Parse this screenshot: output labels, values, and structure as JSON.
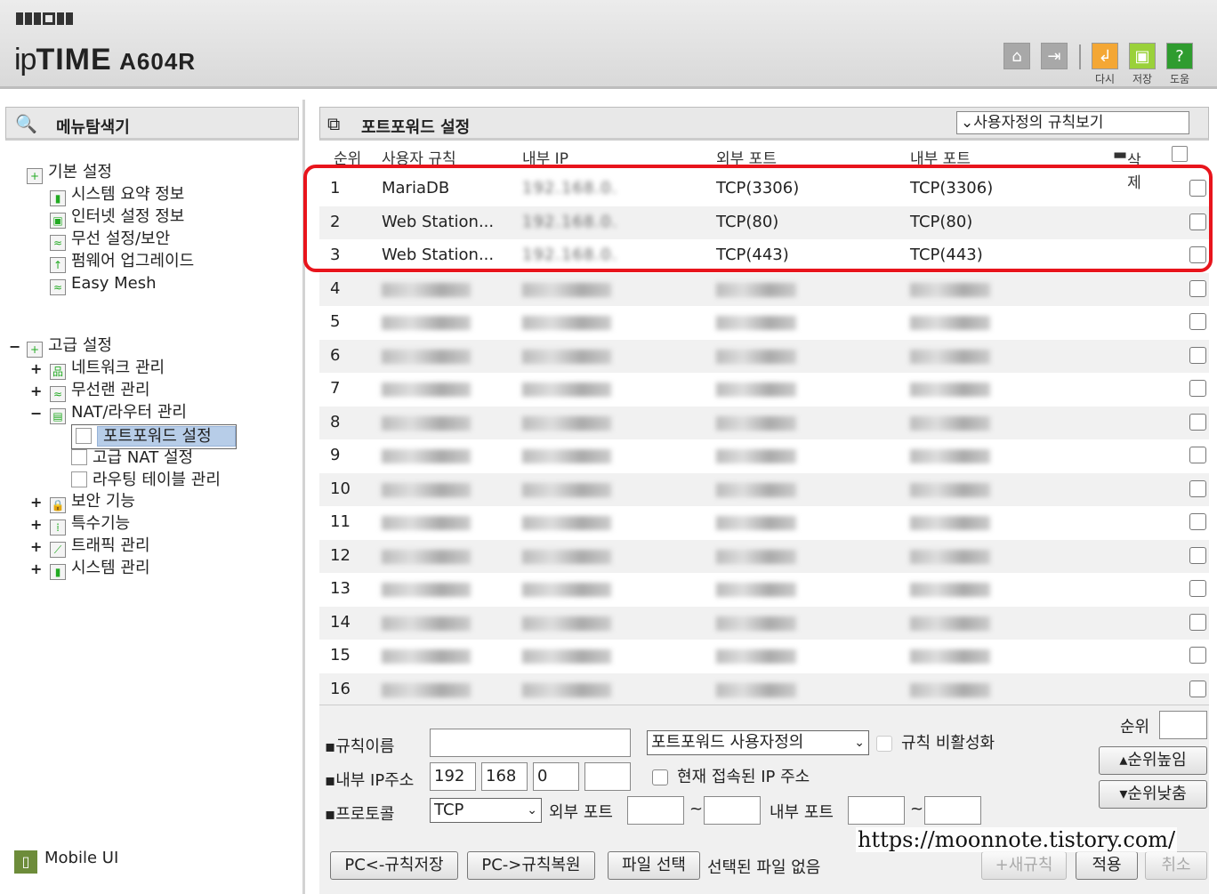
{
  "header": {
    "product": "A604R",
    "brand_prefix": "ip",
    "brand_main": "TIME",
    "toolbar": [
      {
        "icon": "home-icon",
        "label": ""
      },
      {
        "icon": "logout-icon",
        "label": ""
      },
      {
        "icon": "restart-icon",
        "label": "다시"
      },
      {
        "icon": "save-icon",
        "label": "저장"
      },
      {
        "icon": "help-icon",
        "label": "도움"
      }
    ]
  },
  "sidebar": {
    "title": "메뉴탐색기",
    "basic": {
      "label": "기본 설정",
      "items": [
        "시스템 요약 정보",
        "인터넷 설정 정보",
        "무선 설정/보안",
        "펌웨어 업그레이드",
        "Easy Mesh"
      ]
    },
    "advanced": {
      "label": "고급 설정",
      "items": [
        "네트워크 관리",
        "무선랜 관리",
        "NAT/라우터 관리",
        "보안 기능",
        "특수기능",
        "트래픽 관리",
        "시스템 관리"
      ],
      "nat_children": [
        "포트포워드 설정",
        "고급 NAT 설정",
        "라우팅 테이블 관리"
      ]
    },
    "mobile": "Mobile UI"
  },
  "main": {
    "title": "포트포워드 설정",
    "view_select": "사용자정의 규칙보기",
    "columns": {
      "rank": "순위",
      "rule": "사용자 규칙",
      "internal_ip": "내부 IP",
      "external_port": "외부 포트",
      "internal_port": "내부 포트",
      "delete": "삭제"
    },
    "rows": [
      {
        "n": "1",
        "rule": "MariaDB",
        "ip": "192.168.0.",
        "ext": "TCP(3306)",
        "int": "TCP(3306)"
      },
      {
        "n": "2",
        "rule": "Web Station...",
        "ip": "192.168.0.",
        "ext": "TCP(80)",
        "int": "TCP(80)"
      },
      {
        "n": "3",
        "rule": "Web Station...",
        "ip": "192.168.0.",
        "ext": "TCP(443)",
        "int": "TCP(443)"
      },
      {
        "n": "4",
        "rule": "",
        "ip": "",
        "ext": "",
        "int": ""
      },
      {
        "n": "5",
        "rule": "",
        "ip": "",
        "ext": "",
        "int": ""
      },
      {
        "n": "6",
        "rule": "",
        "ip": "",
        "ext": "",
        "int": ""
      },
      {
        "n": "7",
        "rule": "",
        "ip": "",
        "ext": "",
        "int": ""
      },
      {
        "n": "8",
        "rule": "",
        "ip": "",
        "ext": "",
        "int": ""
      },
      {
        "n": "9",
        "rule": "",
        "ip": "",
        "ext": "",
        "int": ""
      },
      {
        "n": "10",
        "rule": "",
        "ip": "",
        "ext": "",
        "int": ""
      },
      {
        "n": "11",
        "rule": "",
        "ip": "",
        "ext": "",
        "int": ""
      },
      {
        "n": "12",
        "rule": "",
        "ip": "",
        "ext": "",
        "int": ""
      },
      {
        "n": "13",
        "rule": "",
        "ip": "",
        "ext": "",
        "int": ""
      },
      {
        "n": "14",
        "rule": "",
        "ip": "",
        "ext": "",
        "int": ""
      },
      {
        "n": "15",
        "rule": "",
        "ip": "",
        "ext": "",
        "int": ""
      },
      {
        "n": "16",
        "rule": "",
        "ip": "",
        "ext": "",
        "int": ""
      }
    ]
  },
  "form": {
    "rule_name_label": "규칙이름",
    "rule_type": "포트포워드 사용자정의",
    "disable_label": "규칙 비활성화",
    "ip_label": "내부 IP주소",
    "ip1": "192",
    "ip2": "168",
    "ip3": "0",
    "ip4": "",
    "current_ip_label": "현재 접속된 IP 주소",
    "protocol_label": "프로토콜",
    "protocol": "TCP",
    "ext_port_label": "외부 포트",
    "int_port_label": "내부 포트",
    "tilde": "~",
    "rank_label": "순위",
    "up_btn": "순위높임",
    "down_btn": "순위낮춤",
    "save_btn": "PC<-규칙저장",
    "restore_btn": "PC->규칙복원",
    "file_btn": "파일 선택",
    "no_file": "선택된 파일 없음",
    "new_btn": "새규칙",
    "apply_btn": "적용",
    "cancel_btn": "취소"
  },
  "watermark": "https://moonnote.tistory.com/"
}
